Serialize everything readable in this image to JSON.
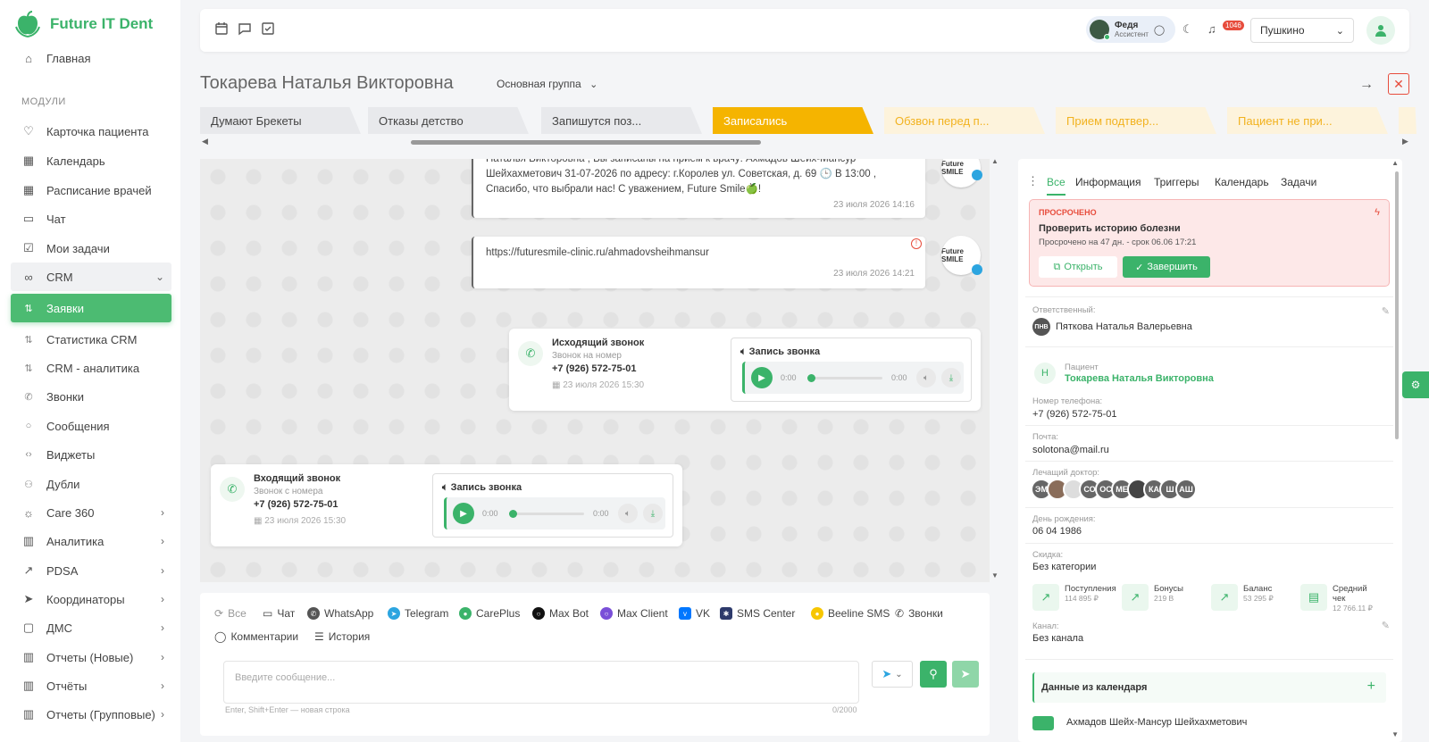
{
  "app": {
    "logo_text": "Future IT Dent"
  },
  "sidebar": {
    "home": "Главная",
    "section": "МОДУЛИ",
    "items": [
      {
        "label": "Карточка пациента",
        "icon": "heart-icon"
      },
      {
        "label": "Календарь",
        "icon": "calendar-icon"
      },
      {
        "label": "Расписание врачей",
        "icon": "calendar-icon"
      },
      {
        "label": "Чат",
        "icon": "chat-icon"
      },
      {
        "label": "Мои задачи",
        "icon": "checkbox-icon"
      },
      {
        "label": "CRM",
        "icon": "crm-icon"
      },
      {
        "label": "Заявки",
        "icon": "sort-icon"
      },
      {
        "label": "Статистика CRM",
        "icon": "sort-icon"
      },
      {
        "label": "CRM - аналитика",
        "icon": "sort-icon"
      },
      {
        "label": "Звонки",
        "icon": "phone-icon"
      },
      {
        "label": "Сообщения",
        "icon": "message-icon"
      },
      {
        "label": "Виджеты",
        "icon": "code-icon"
      },
      {
        "label": "Дубли",
        "icon": "users-icon"
      },
      {
        "label": "Care 360",
        "icon": "sun-icon"
      },
      {
        "label": "Аналитика",
        "icon": "bar-chart-icon"
      },
      {
        "label": "PDSA",
        "icon": "trend-icon"
      },
      {
        "label": "Координаторы",
        "icon": "send-icon"
      },
      {
        "label": "ДМС",
        "icon": "clipboard-icon"
      },
      {
        "label": "Отчеты (Новые)",
        "icon": "bar-chart-icon"
      },
      {
        "label": "Отчёты",
        "icon": "bar-chart-icon"
      },
      {
        "label": "Отчеты (Групповые)",
        "icon": "bar-chart-icon"
      }
    ]
  },
  "header": {
    "user_name": "Федя",
    "user_role": "Ассистент",
    "notifications": "1046",
    "branch": "Пушкино"
  },
  "patient": {
    "title": "Токарева Наталья Викторовна",
    "group": "Основная группа"
  },
  "pipeline": [
    "Думают Брекеты",
    "Отказы детство",
    "Запишутся поз...",
    "Записались",
    "Обзвон перед п...",
    "Прием подтвер...",
    "Пациент не при..."
  ],
  "chat": {
    "msg1_text": "Наталья Викторовна , Вы записаны на прием к врачу: Ахмадов Шейх-Мансур Шейхахметович 31-07-2026 по адресу: г.Королев ул. Советская, д. 69 🕒 В 13:00 , Спасибо, что выбрали нас! С уважением, Future Smile🍏!",
    "msg1_time": "23 июля 2026 14:16",
    "msg2_text": "https://futuresmile-clinic.ru/ahmadovsheihmansur",
    "msg2_time": "23 июля 2026 14:21",
    "clinic_avatar": "Future SMILE",
    "out_call": {
      "title": "Исходящий звонок",
      "sub": "Звонок на номер",
      "phone": "+7 (926) 572-75-01",
      "date": "23 июля 2026 15:30",
      "rec_label": "Запись звонка",
      "t1": "0:00",
      "t2": "0:00"
    },
    "in_call": {
      "title": "Входящий звонок",
      "sub": "Звонок с номера",
      "phone": "+7 (926) 572-75-01",
      "date": "23 июля 2026 15:30",
      "rec_label": "Запись звонка",
      "t1": "0:00",
      "t2": "0:00"
    }
  },
  "composer": {
    "channels": [
      "Все",
      "Чат",
      "WhatsApp",
      "Telegram",
      "CarePlus",
      "Max Bot",
      "Max Client",
      "VK",
      "SMS Center",
      "Beeline SMS",
      "Звонки"
    ],
    "channels2": [
      "Комментарии",
      "История"
    ],
    "placeholder": "Введите сообщение...",
    "hint": "Enter, Shift+Enter — новая строка",
    "counter": "0/2000"
  },
  "rpanel": {
    "tabs": [
      "Все",
      "Информация",
      "Триггеры",
      "Календарь",
      "Задачи"
    ],
    "overdue": {
      "tag": "ПРОСРОЧЕНО",
      "title": "Проверить историю болезни",
      "desc": "Просрочено на 47 дн. - срок 06.06 17:21",
      "open": "Открыть",
      "finish": "Завершить"
    },
    "responsible_label": "Ответственный:",
    "responsible_initials": "ПНВ",
    "responsible_name": "Пяткова Наталья Валерьевна",
    "patient_label": "Пациент",
    "patient_initial": "Н",
    "patient_name": "Токарева Наталья Викторовна",
    "phone_label": "Номер телефона:",
    "phone": "+7 (926) 572-75-01",
    "email_label": "Почта:",
    "email": "solotona@mail.ru",
    "doctor_label": "Лечащий доктор:",
    "doctors": [
      "ЭМ",
      "",
      "",
      "СО",
      "ОС",
      "МЕ",
      "",
      "КА",
      "Ш",
      "АШ"
    ],
    "birthday_label": "День рождения:",
    "birthday": "06 04 1986",
    "discount_label": "Скидка:",
    "discount": "Без категории",
    "stats": [
      {
        "title": "Поступления",
        "value": "114 895 ₽"
      },
      {
        "title": "Бонусы",
        "value": "219 B"
      },
      {
        "title": "Баланс",
        "value": "53 295 ₽"
      },
      {
        "title": "Средний чек",
        "value": "12 766.11 ₽"
      }
    ],
    "channel_label": "Канал:",
    "channel": "Без канала",
    "calendar_data": "Данные из календаря",
    "doctor_row": "Ахмадов Шейх-Мансур Шейхахметович"
  },
  "colors": {
    "accent": "#3bb36a",
    "stage_active": "#f5b400",
    "overdue_bg": "#fde8e8"
  }
}
